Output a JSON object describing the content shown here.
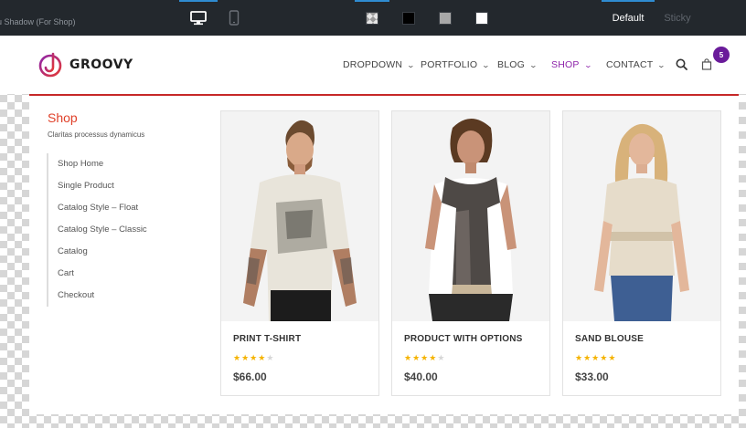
{
  "toolbar": {
    "title": "nu Shadow (For Shop)",
    "views": [
      {
        "icon": "desktop-icon",
        "active": true
      },
      {
        "icon": "mobile-icon",
        "active": false
      }
    ],
    "swatches": [
      {
        "name": "transparent",
        "color": "#e6e6e6",
        "active": true
      },
      {
        "name": "black",
        "color": "#000000",
        "active": false
      },
      {
        "name": "grey",
        "color": "#a8a8a8",
        "active": false
      },
      {
        "name": "white",
        "color": "#ffffff",
        "active": false
      }
    ],
    "default_label": "Default",
    "sticky_label": "Sticky"
  },
  "header": {
    "logo_text": "GROOVY",
    "nav": [
      {
        "label": "DROPDOWN",
        "active": false
      },
      {
        "label": "PORTFOLIO",
        "active": false
      },
      {
        "label": "BLOG",
        "active": false
      },
      {
        "label": "SHOP",
        "active": true
      },
      {
        "label": "CONTACT",
        "active": false
      }
    ],
    "cart_count": "5"
  },
  "mega_menu": {
    "title": "Shop",
    "subtitle": "Claritas processus dynamicus",
    "links": [
      "Shop Home",
      "Single Product",
      "Catalog Style – Float",
      "Catalog Style – Classic",
      "Catalog",
      "Cart",
      "Checkout"
    ],
    "products": [
      {
        "name": "PRINT T-SHIRT",
        "rating": 4,
        "price": "$66.00"
      },
      {
        "name": "PRODUCT WITH OPTIONS",
        "rating": 4,
        "price": "$40.00"
      },
      {
        "name": "SAND BLOUSE",
        "rating": 5,
        "price": "$33.00"
      }
    ]
  },
  "colors": {
    "accent": "#8e24aa",
    "panel_border": "#c62828",
    "shop_title": "#e0412a",
    "star_on": "#f5b301",
    "star_off": "#d7d7d7",
    "toolbar_bg": "#23282d"
  }
}
